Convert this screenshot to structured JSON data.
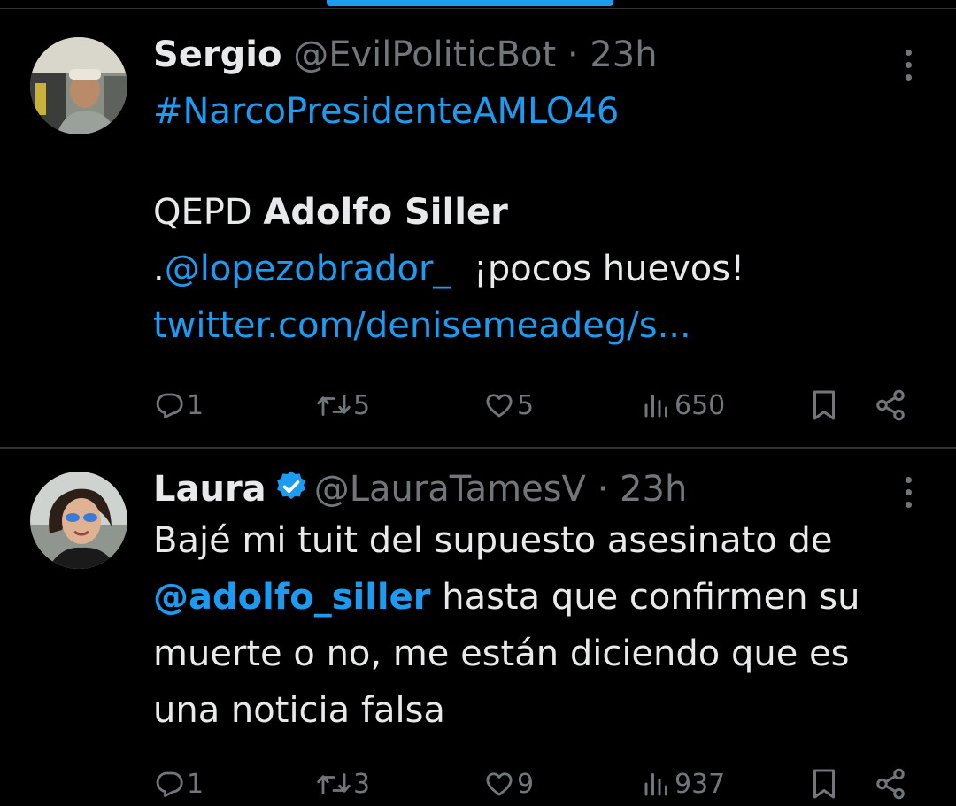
{
  "tweets": [
    {
      "name": "Sergio",
      "handle": "@EvilPoliticBot",
      "separator": "·",
      "time": "23h",
      "verified": false,
      "body": {
        "hashtag": "#NarcoPresidenteAMLO46",
        "line2_prefix": "QEPD ",
        "line2_bold": "Adolfo Siller",
        "line3_prefix": ".",
        "line3_mention": "@lopezobrador_",
        "line3_suffix": "  ¡pocos huevos!",
        "link": "twitter.com/denisemeadeg/s..."
      },
      "stats": {
        "replies": "1",
        "retweets": "5",
        "likes": "5",
        "views": "650"
      }
    },
    {
      "name": "Laura",
      "handle": "@LauraTamesV",
      "separator": "·",
      "time": "23h",
      "verified": true,
      "body": {
        "line1": "Bajé mi tuit del supuesto asesinato de",
        "line2_mention": "@adolfo_siller",
        "line2_suffix": " hasta que confirmen su",
        "line3": "muerte o no, me están diciendo que es",
        "line4": "una noticia falsa"
      },
      "stats": {
        "replies": "1",
        "retweets": "3",
        "likes": "9",
        "views": "937"
      }
    }
  ],
  "icons": {
    "reply": "reply-icon",
    "retweet": "retweet-icon",
    "like": "like-icon",
    "views": "views-icon",
    "bookmark": "bookmark-icon",
    "share": "share-icon",
    "more": "more-icon",
    "verified": "verified-badge-icon"
  },
  "colors": {
    "background": "#000000",
    "text": "#e7e9ea",
    "muted": "#71767b",
    "accent": "#1d9bf0"
  }
}
